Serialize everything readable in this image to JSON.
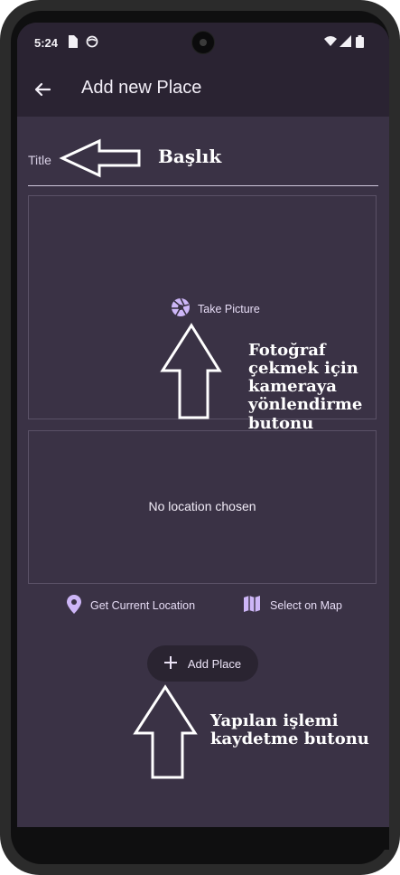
{
  "status_bar": {
    "time": "5:24"
  },
  "app_bar": {
    "title": "Add new Place"
  },
  "form": {
    "title_placeholder": "Title",
    "take_picture_label": "Take Picture",
    "no_location_text": "No location chosen",
    "get_location_label": "Get Current Location",
    "select_map_label": "Select on Map",
    "add_place_label": "Add Place"
  },
  "annotations": {
    "title_note": "Başlık",
    "camera_note": [
      "Fotoğraf",
      "çekmek için",
      "kameraya",
      "yönlendirme",
      "butonu"
    ],
    "save_note": [
      "Yapılan işlemi",
      "kaydetme butonu"
    ]
  },
  "colors": {
    "background": "#3a3245",
    "app_bar": "#2a2332",
    "accent": "#cdb6f7"
  }
}
